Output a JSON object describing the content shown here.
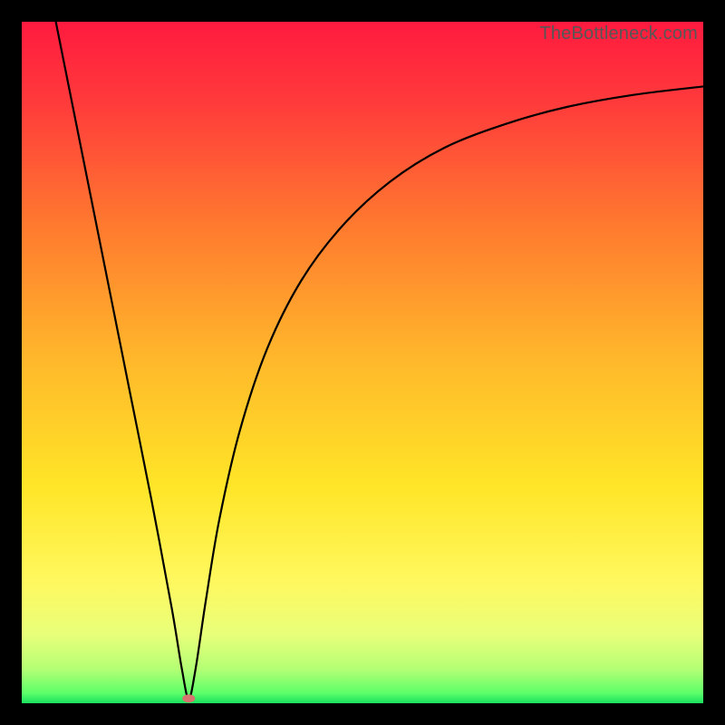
{
  "watermark": "TheBottleneck.com",
  "chart_data": {
    "type": "line",
    "title": "",
    "xlabel": "",
    "ylabel": "",
    "xlim": [
      0,
      100
    ],
    "ylim": [
      0,
      100
    ],
    "background_gradient": {
      "stops": [
        {
          "offset": 0.0,
          "color": "#ff1a3f"
        },
        {
          "offset": 0.12,
          "color": "#ff3b3b"
        },
        {
          "offset": 0.3,
          "color": "#ff7a2f"
        },
        {
          "offset": 0.5,
          "color": "#ffb92b"
        },
        {
          "offset": 0.68,
          "color": "#ffe527"
        },
        {
          "offset": 0.82,
          "color": "#fff85e"
        },
        {
          "offset": 0.9,
          "color": "#e8ff7a"
        },
        {
          "offset": 0.95,
          "color": "#b4ff74"
        },
        {
          "offset": 0.985,
          "color": "#5dff6a"
        },
        {
          "offset": 1.0,
          "color": "#19e05f"
        }
      ]
    },
    "marker": {
      "x": 24.5,
      "y": 0.7,
      "color": "#d7746f"
    },
    "series": [
      {
        "name": "bottleneck-curve",
        "color": "#000000",
        "width": 2.2,
        "points": [
          {
            "x": 5.0,
            "y": 100.0
          },
          {
            "x": 7.0,
            "y": 90.0
          },
          {
            "x": 10.0,
            "y": 75.0
          },
          {
            "x": 13.0,
            "y": 60.0
          },
          {
            "x": 16.0,
            "y": 45.0
          },
          {
            "x": 19.0,
            "y": 30.0
          },
          {
            "x": 22.0,
            "y": 14.0
          },
          {
            "x": 23.5,
            "y": 5.0
          },
          {
            "x": 24.5,
            "y": 0.7
          },
          {
            "x": 25.5,
            "y": 5.0
          },
          {
            "x": 27.0,
            "y": 15.0
          },
          {
            "x": 29.0,
            "y": 27.0
          },
          {
            "x": 32.0,
            "y": 40.0
          },
          {
            "x": 36.0,
            "y": 52.0
          },
          {
            "x": 41.0,
            "y": 62.0
          },
          {
            "x": 47.0,
            "y": 70.0
          },
          {
            "x": 54.0,
            "y": 76.5
          },
          {
            "x": 62.0,
            "y": 81.5
          },
          {
            "x": 71.0,
            "y": 85.0
          },
          {
            "x": 80.0,
            "y": 87.5
          },
          {
            "x": 90.0,
            "y": 89.3
          },
          {
            "x": 100.0,
            "y": 90.5
          }
        ]
      }
    ]
  }
}
